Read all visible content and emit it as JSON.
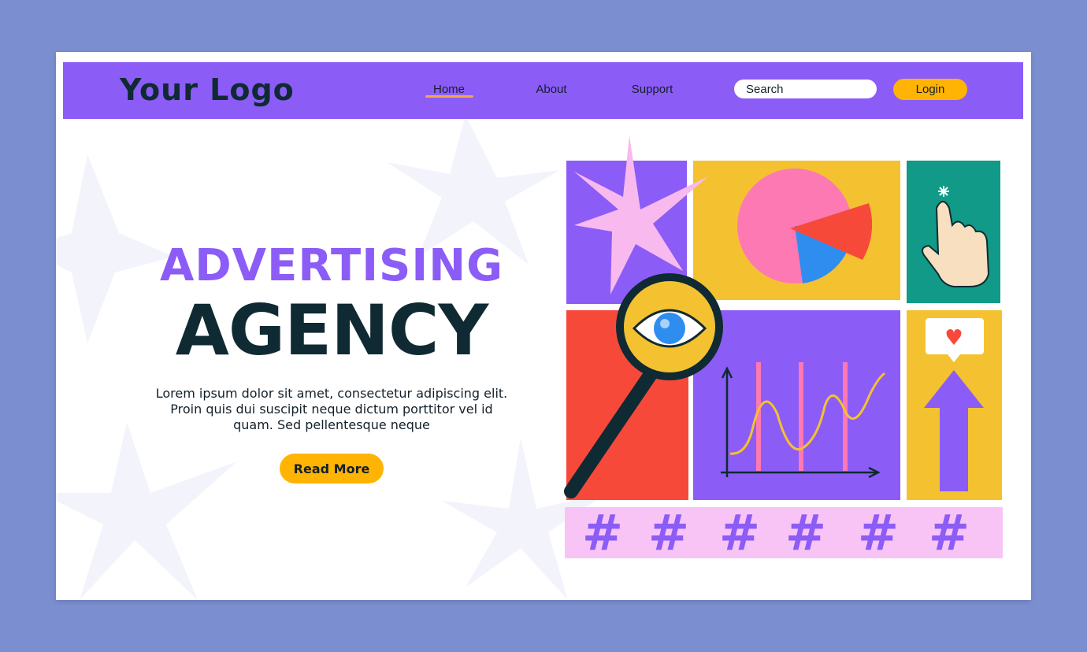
{
  "navbar": {
    "logo": "Your Logo",
    "links": [
      {
        "label": "Home",
        "active": true
      },
      {
        "label": "About",
        "active": false
      },
      {
        "label": "Support",
        "active": false
      }
    ],
    "search_placeholder": "Search",
    "login_label": "Login"
  },
  "hero": {
    "headline_line1": "ADVERTISING",
    "headline_line2": "AGENCY",
    "body_line1": "Lorem ipsum dolor sit amet, consectetur adipiscing elit.",
    "body_line2": "Proin quis dui suscipit neque dictum porttitor vel id",
    "body_line3": "quam. Sed pellentesque neque",
    "cta_label": "Read More"
  },
  "illustration": {
    "hashtags": [
      "#",
      "#",
      "#",
      "#",
      "#",
      "#"
    ],
    "icons": [
      "star-icon",
      "pie-chart-icon",
      "pointing-hand-icon",
      "magnifying-glass-icon",
      "eye-icon",
      "line-chart-icon",
      "heart-bubble-icon",
      "up-arrow-icon",
      "hashtag-icon"
    ]
  },
  "colors": {
    "page_background": "#7b8fd0",
    "brand_purple": "#8c5cf7",
    "dark_text": "#0f2a32",
    "accent_yellow": "#ffb404",
    "tile_yellow": "#f4c230",
    "tile_red": "#f7493a",
    "tile_teal": "#109a87",
    "tile_pink": "#f8c4f6"
  }
}
